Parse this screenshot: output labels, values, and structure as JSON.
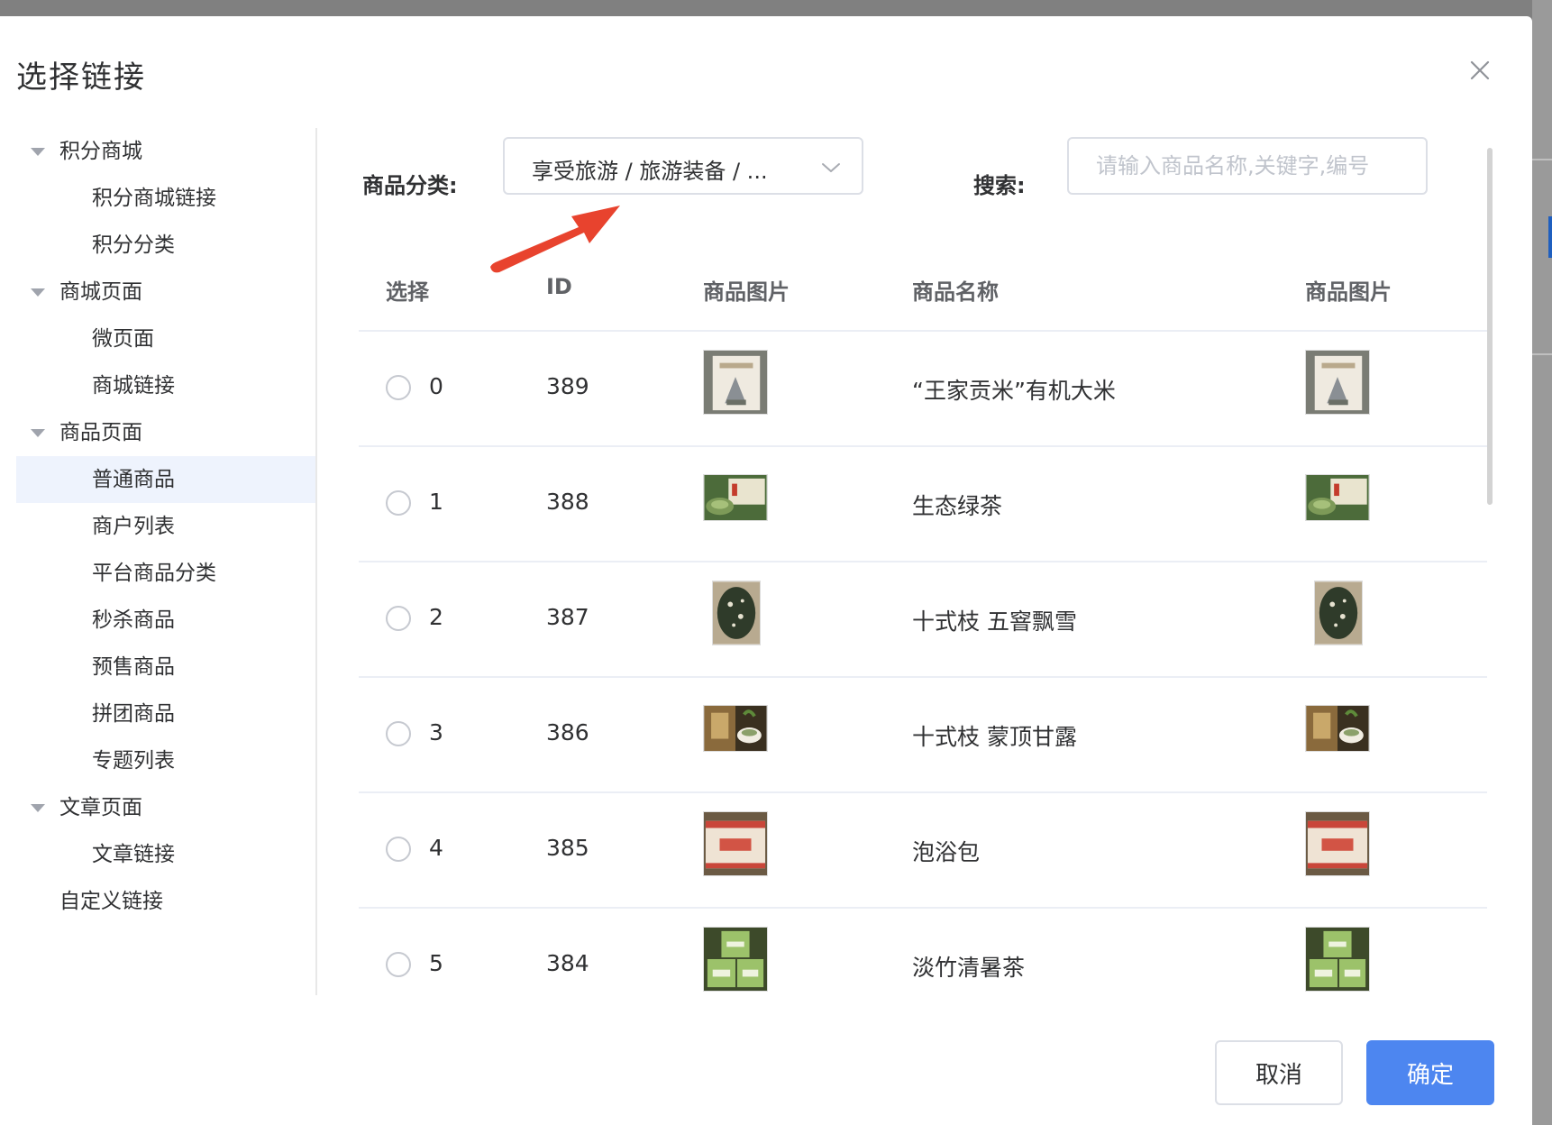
{
  "dialog": {
    "title": "选择链接"
  },
  "sidebar": {
    "groups": [
      {
        "label": "积分商城",
        "items": [
          "积分商城链接",
          "积分分类"
        ]
      },
      {
        "label": "商城页面",
        "items": [
          "微页面",
          "商城链接"
        ]
      },
      {
        "label": "商品页面",
        "items": [
          "普通商品",
          "商户列表",
          "平台商品分类",
          "秒杀商品",
          "预售商品",
          "拼团商品",
          "专题列表"
        ]
      },
      {
        "label": "文章页面",
        "items": [
          "文章链接"
        ]
      }
    ],
    "extra": "自定义链接",
    "active_item": "普通商品"
  },
  "filter": {
    "category_label": "商品分类:",
    "category_value": "享受旅游 / 旅游装备 / ...",
    "search_label": "搜索:",
    "search_placeholder": "请输入商品名称,关键字,编号"
  },
  "table": {
    "headers": [
      "选择",
      "ID",
      "商品图片",
      "商品名称",
      "商品图片"
    ],
    "rows": [
      {
        "index": "0",
        "id": "389",
        "name": "“王家贡米”有机大米",
        "thumb": "rice-box"
      },
      {
        "index": "1",
        "id": "388",
        "name": "生态绿茶",
        "thumb": "green-tea"
      },
      {
        "index": "2",
        "id": "387",
        "name": "十式枝 五窨飘雪",
        "thumb": "tea-leaves"
      },
      {
        "index": "3",
        "id": "386",
        "name": "十式枝 蒙顶甘露",
        "thumb": "tea-cup"
      },
      {
        "index": "4",
        "id": "385",
        "name": "泡浴包",
        "thumb": "bath-box"
      },
      {
        "index": "5",
        "id": "384",
        "name": "淡竹清暑茶",
        "thumb": "tea-boxes"
      }
    ]
  },
  "footer": {
    "cancel_label": "取消",
    "ok_label": "确定"
  },
  "colors": {
    "primary": "#4d86f0",
    "annotation_arrow": "#e8432e",
    "active_bg": "#eef3fd"
  }
}
